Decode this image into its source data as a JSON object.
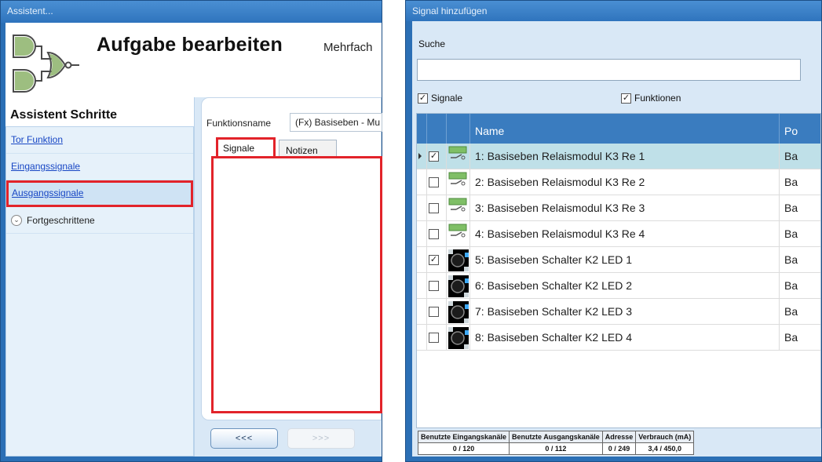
{
  "wizard": {
    "window_title": "Assistent...",
    "page_title": "Aufgabe bearbeiten",
    "page_subtitle": "Mehrfach",
    "steps_title": "Assistent Schritte",
    "steps": [
      {
        "label": "Tor Funktion"
      },
      {
        "label": "Eingangssignale"
      },
      {
        "label": "Ausgangssignale"
      },
      {
        "label": "Fortgeschrittene"
      }
    ],
    "function_name_label": "Funktionsname",
    "function_name_value": "(Fx) Basiseben - Mu",
    "tabs": [
      {
        "label": "Signale"
      },
      {
        "label": "Notizen"
      }
    ],
    "back_button": "<<<",
    "next_button": ">>>",
    "colors": {
      "highlight": "#e2232a",
      "window": "#2b6fb5"
    }
  },
  "dialog": {
    "window_title": "Signal hinzufügen",
    "search_label": "Suche",
    "search_value": "",
    "filter_signals": {
      "label": "Signale",
      "checked": true
    },
    "filter_functions": {
      "label": "Funktionen",
      "checked": true
    },
    "columns": [
      "Name",
      "Po"
    ],
    "rows": [
      {
        "icon": "relay-icon",
        "checked": true,
        "name": "1: Basiseben Relaismodul K3 Re 1",
        "pos": "Ba"
      },
      {
        "icon": "relay-icon",
        "checked": false,
        "name": "2: Basiseben Relaismodul K3 Re 2",
        "pos": "Ba"
      },
      {
        "icon": "relay-icon",
        "checked": false,
        "name": "3: Basiseben Relaismodul K3 Re 3",
        "pos": "Ba"
      },
      {
        "icon": "relay-icon",
        "checked": false,
        "name": "4: Basiseben Relaismodul K3 Re 4",
        "pos": "Ba"
      },
      {
        "icon": "led-icon",
        "checked": true,
        "name": "5: Basiseben Schalter K2 LED 1",
        "pos": "Ba"
      },
      {
        "icon": "led-icon",
        "checked": false,
        "name": "6: Basiseben Schalter K2 LED 2",
        "pos": "Ba"
      },
      {
        "icon": "led-icon",
        "checked": false,
        "name": "7: Basiseben Schalter K2 LED 3",
        "pos": "Ba"
      },
      {
        "icon": "led-icon",
        "checked": false,
        "name": "8: Basiseben Schalter K2 LED 4",
        "pos": "Ba"
      }
    ],
    "status": [
      {
        "header": "Benutzte Eingangskanäle",
        "value": "0 / 120"
      },
      {
        "header": "Benutzte Ausgangskanäle",
        "value": "0 / 112"
      },
      {
        "header": "Adresse",
        "value": "0 / 249"
      },
      {
        "header": "Verbrauch (mA)",
        "value": "3,4 / 450,0"
      }
    ],
    "colors": {
      "grid_header": "#3a7cbf",
      "selected_row": "#bfe0e8"
    }
  }
}
